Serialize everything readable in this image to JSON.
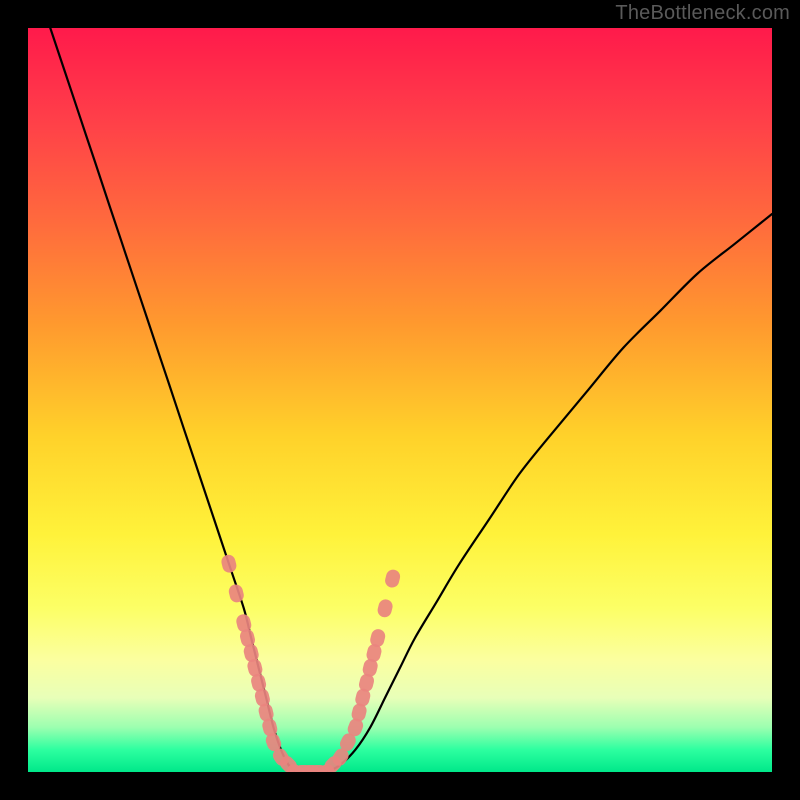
{
  "watermark": {
    "text": "TheBottleneck.com"
  },
  "colors": {
    "background": "#000000",
    "curve_stroke": "#000000",
    "marker_fill": "#e9847f",
    "gradient_top": "#ff1a4b",
    "gradient_bottom": "#00e88a"
  },
  "chart_data": {
    "type": "line",
    "title": "",
    "xlabel": "",
    "ylabel": "",
    "xlim": [
      0,
      100
    ],
    "ylim": [
      0,
      100
    ],
    "grid": false,
    "legend": false,
    "series": [
      {
        "name": "bottleneck-curve",
        "x": [
          3,
          5,
          7,
          9,
          11,
          13,
          15,
          17,
          19,
          21,
          23,
          25,
          27,
          29,
          30,
          31,
          32,
          33,
          34,
          35,
          36,
          37,
          38,
          40,
          42,
          44,
          46,
          48,
          50,
          52,
          55,
          58,
          62,
          66,
          70,
          75,
          80,
          85,
          90,
          95,
          100
        ],
        "y": [
          100,
          94,
          88,
          82,
          76,
          70,
          64,
          58,
          52,
          46,
          40,
          34,
          28,
          22,
          18,
          14,
          10,
          6,
          3,
          1,
          0,
          0,
          0,
          0,
          1,
          3,
          6,
          10,
          14,
          18,
          23,
          28,
          34,
          40,
          45,
          51,
          57,
          62,
          67,
          71,
          75
        ]
      }
    ],
    "markers": {
      "name": "highlighted-points",
      "comment": "Salmon capsule markers highlighting the near-zero region of the curve",
      "x": [
        27,
        28,
        29,
        29.5,
        30,
        30.5,
        31,
        31.5,
        32,
        32.5,
        33,
        34,
        35,
        36,
        37,
        38,
        39,
        40,
        41,
        42,
        43,
        44,
        44.5,
        45,
        45.5,
        46,
        46.5,
        47,
        48,
        49
      ],
      "y": [
        28,
        24,
        20,
        18,
        16,
        14,
        12,
        10,
        8,
        6,
        4,
        2,
        1,
        0,
        0,
        0,
        0,
        0,
        1,
        2,
        4,
        6,
        8,
        10,
        12,
        14,
        16,
        18,
        22,
        26
      ]
    }
  }
}
